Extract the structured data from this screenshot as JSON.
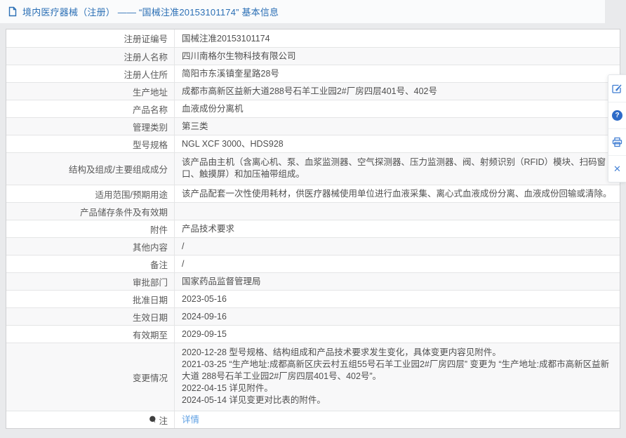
{
  "header": {
    "title": "境内医疗器械（注册） —— “国械注准20153101174” 基本信息"
  },
  "table": {
    "rows": [
      {
        "label": "注册证编号",
        "value": "国械注准20153101174"
      },
      {
        "label": "注册人名称",
        "value": "四川南格尔生物科技有限公司"
      },
      {
        "label": "注册人住所",
        "value": "简阳市东溪镇奎星路28号"
      },
      {
        "label": "生产地址",
        "value": "成都市高新区益新大道288号石羊工业园2#厂房四层401号、402号"
      },
      {
        "label": "产品名称",
        "value": "血液成份分离机"
      },
      {
        "label": "管理类别",
        "value": "第三类"
      },
      {
        "label": "型号规格",
        "value": "NGL XCF 3000、HDS928"
      },
      {
        "label": "结构及组成/主要组成成分",
        "value": "该产品由主机（含离心机、泵、血浆监测器、空气探测器、压力监测器、阀、射频识别（RFID）模块、扫码窗口、触摸屏）和加压袖带组成。"
      },
      {
        "label": "适用范围/预期用途",
        "value": "该产品配套一次性使用耗材，供医疗器械使用单位进行血液采集、离心式血液成份分离、血液成份回输或清除。"
      },
      {
        "label": "产品储存条件及有效期",
        "value": ""
      },
      {
        "label": "附件",
        "value": "产品技术要求"
      },
      {
        "label": "其他内容",
        "value": "/"
      },
      {
        "label": "备注",
        "value": "/"
      },
      {
        "label": "审批部门",
        "value": "国家药品监督管理局"
      },
      {
        "label": "批准日期",
        "value": "2023-05-16"
      },
      {
        "label": "生效日期",
        "value": "2024-09-16"
      },
      {
        "label": "有效期至",
        "value": "2029-09-15"
      },
      {
        "label": "变更情况",
        "lines": [
          "2020-12-28 型号规格、结构组成和产品技术要求发生变化，具体变更内容见附件。",
          "2021-03-25 “生产地址:成都高新区庆云村五组55号石羊工业园2#厂房四层” 变更为 “生产地址:成都市高新区益新大道 288号石羊工业园2#厂房四层401号、402号”。",
          "2022-04-15 详见附件。",
          "2024-05-14 详见变更对比表的附件。"
        ]
      },
      {
        "label": "注",
        "value": "详情"
      }
    ]
  },
  "toolbar": {
    "icons": [
      "edit-icon",
      "help-icon",
      "print-icon",
      "close-icon"
    ],
    "help_glyph": "?",
    "close_glyph": "✕"
  },
  "colors": {
    "title_blue": "#2b6fb5",
    "link_blue": "#5d9fe3",
    "icon_blue": "#3f7dd2",
    "row_alt": "#f8f8f9",
    "page_bg": "#e9eaec"
  }
}
